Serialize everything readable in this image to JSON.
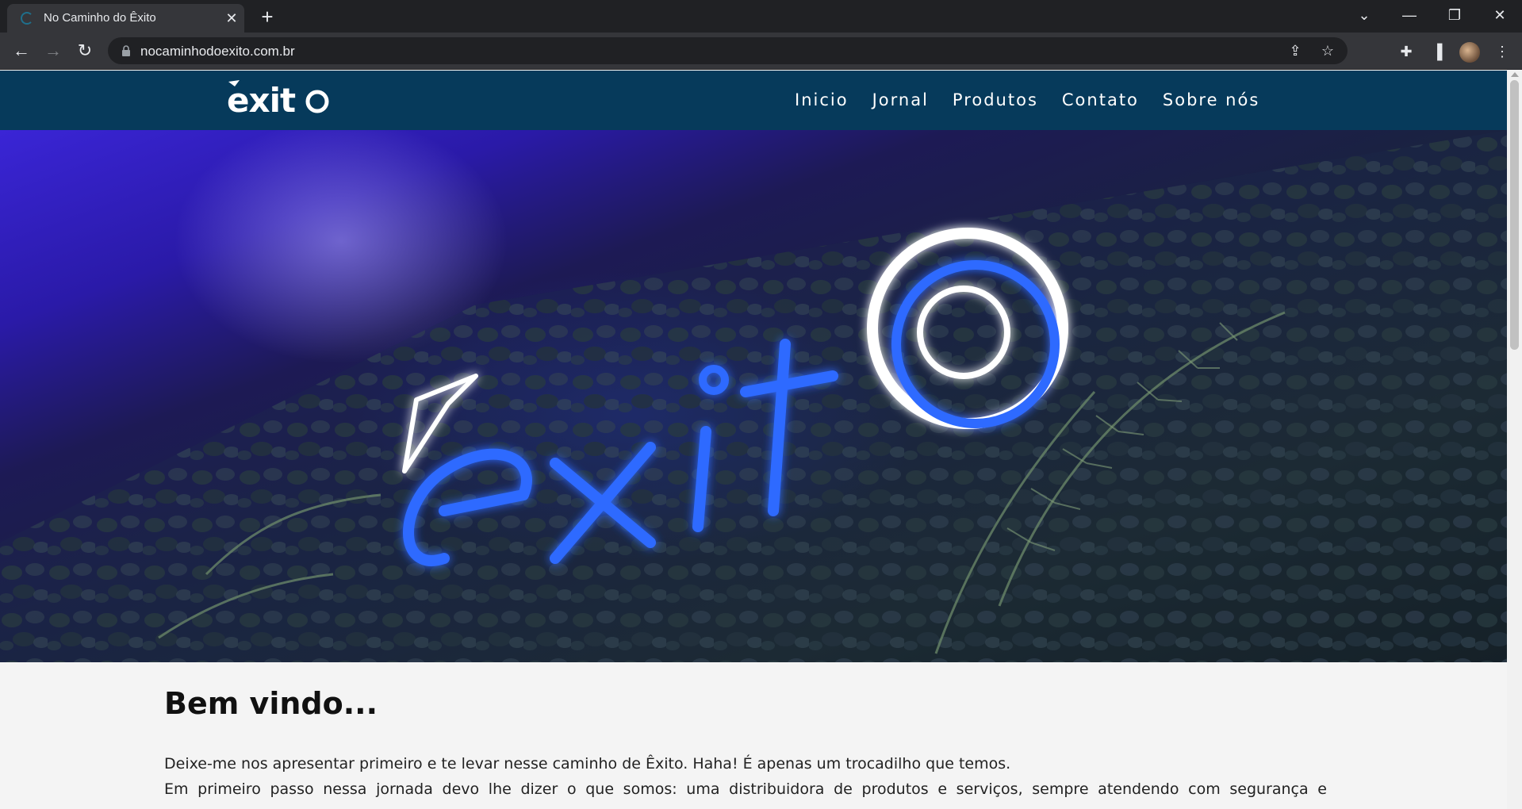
{
  "browser": {
    "tab_title": "No Caminho do Êxito",
    "url": "nocaminhodoexito.com.br"
  },
  "site": {
    "logo_text": "'exito",
    "nav": [
      "Inicio",
      "Jornal",
      "Produtos",
      "Contato",
      "Sobre nós"
    ],
    "header_color": "#063a5b"
  },
  "hero": {
    "sign_text": "'exito",
    "neon_color": "#2f6bff"
  },
  "content": {
    "heading": "Bem vindo...",
    "paragraph_line1": "Deixe-me nos apresentar primeiro e te levar nesse caminho de Êxito. Haha! É apenas um trocadilho que temos.",
    "paragraph_line2": "Em primeiro passo nessa jornada devo lhe dizer o que somos: uma distribuidora de produtos e serviços, sempre atendendo com segurança e"
  }
}
